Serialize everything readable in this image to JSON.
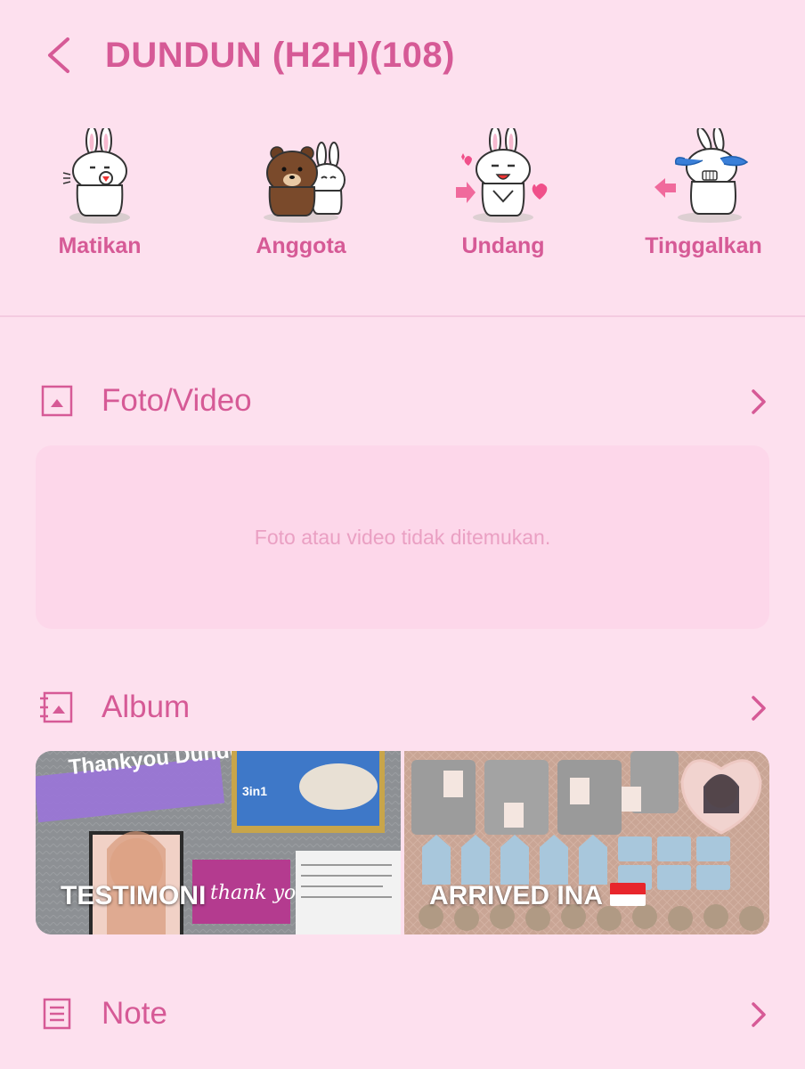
{
  "header": {
    "title": "DUNDUN (H2H)(108)"
  },
  "actions": [
    {
      "label": "Matikan",
      "icon": "bunny-mute-sticker-icon"
    },
    {
      "label": "Anggota",
      "icon": "bear-bunny-members-sticker-icon"
    },
    {
      "label": "Undang",
      "icon": "bunny-invite-sticker-icon"
    },
    {
      "label": "Tinggalkan",
      "icon": "bunny-crying-leave-sticker-icon"
    }
  ],
  "sections": {
    "media": {
      "label": "Foto/Video",
      "empty_message": "Foto atau video tidak ditemukan."
    },
    "album": {
      "label": "Album"
    },
    "note": {
      "label": "Note"
    }
  },
  "albums": [
    {
      "title": "TESTIMONI",
      "overlay_text": "Thankyou Dundun Go",
      "card_text": "thank you"
    },
    {
      "title": "ARRIVED INA"
    }
  ],
  "colors": {
    "background": "#fde0ee",
    "accent": "#d65a96",
    "empty_box": "#fdd7ea",
    "muted_text": "#eaa0c3"
  }
}
